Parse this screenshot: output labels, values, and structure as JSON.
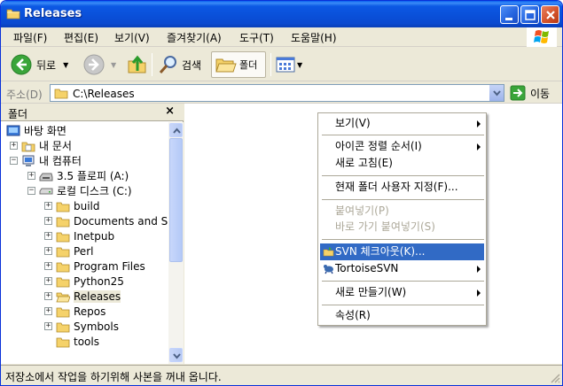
{
  "window": {
    "title": "Releases"
  },
  "menubar": {
    "items": [
      "파일(F)",
      "편집(E)",
      "보기(V)",
      "즐겨찾기(A)",
      "도구(T)",
      "도움말(H)"
    ]
  },
  "toolbar": {
    "back_label": "뒤로",
    "search_label": "검색",
    "folders_label": "폴더"
  },
  "address": {
    "label": "주소(D)",
    "value": "C:\\Releases",
    "go_label": "이동"
  },
  "folderpane": {
    "title": "폴더",
    "close_glyph": "×",
    "tree": [
      {
        "label": "바탕 화면"
      },
      {
        "label": "내 문서"
      },
      {
        "label": "내 컴퓨터"
      },
      {
        "label": "3.5 플로피 (A:)"
      },
      {
        "label": "로컬 디스크 (C:)"
      },
      {
        "label": "build"
      },
      {
        "label": "Documents and S"
      },
      {
        "label": "Inetpub"
      },
      {
        "label": "Perl"
      },
      {
        "label": "Program Files"
      },
      {
        "label": "Python25"
      },
      {
        "label": "Releases"
      },
      {
        "label": "Repos"
      },
      {
        "label": "Symbols"
      },
      {
        "label": "tools"
      }
    ]
  },
  "context_menu": {
    "items": [
      {
        "label": "보기(V)"
      },
      {
        "label": "아이콘 정렬 순서(I)"
      },
      {
        "label": "새로 고침(E)"
      },
      {
        "label": "현재 폴더 사용자 지정(F)..."
      },
      {
        "label": "붙여넣기(P)"
      },
      {
        "label": "바로 가기 붙여넣기(S)"
      },
      {
        "label": "SVN 체크아웃(K)..."
      },
      {
        "label": "TortoiseSVN"
      },
      {
        "label": "새로 만들기(W)"
      },
      {
        "label": "속성(R)"
      }
    ]
  },
  "statusbar": {
    "text": "저장소에서 작업을 하기위해 사본을 꺼내 옵니다."
  },
  "colors": {
    "titlebar": "#0a4fd8",
    "highlight": "#316ac5",
    "folder": "#f5d26a"
  }
}
